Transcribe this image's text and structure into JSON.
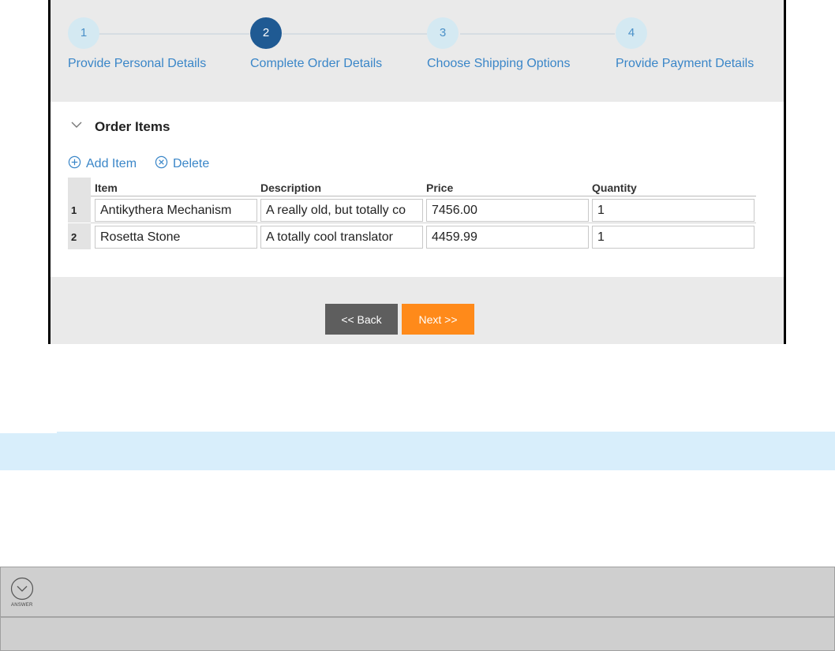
{
  "wizard": {
    "steps": [
      {
        "number": "1",
        "label": "Provide Personal Details"
      },
      {
        "number": "2",
        "label": "Complete Order Details"
      },
      {
        "number": "3",
        "label": "Choose Shipping Options"
      },
      {
        "number": "4",
        "label": "Provide Payment Details"
      }
    ],
    "active_step": "2",
    "colors": {
      "active": "#1f5a93",
      "inactive": "#d4e9f2",
      "link": "#3a86c8"
    }
  },
  "section": {
    "title": "Order Items",
    "toggle_icon": "chevron-down-icon",
    "actions": {
      "add_label": "Add Item",
      "add_icon": "plus-circle-icon",
      "delete_label": "Delete",
      "delete_icon": "x-circle-icon"
    }
  },
  "table": {
    "columns": [
      "Item",
      "Description",
      "Price",
      "Quantity"
    ],
    "rows": [
      {
        "num": "1",
        "item": "Antikythera Mechanism",
        "description": "A really old, but totally co",
        "price": "7456.00",
        "quantity": "1"
      },
      {
        "num": "2",
        "item": "Rosetta Stone",
        "description": "A totally cool translator",
        "price": "4459.99",
        "quantity": "1"
      }
    ]
  },
  "buttons": {
    "back": "<< Back",
    "next": "Next >>",
    "back_color": "#5e5e5e",
    "next_color": "#ff8a1a"
  },
  "answer": {
    "label": "ANSWER",
    "icon": "chevron-down-circle-icon"
  }
}
